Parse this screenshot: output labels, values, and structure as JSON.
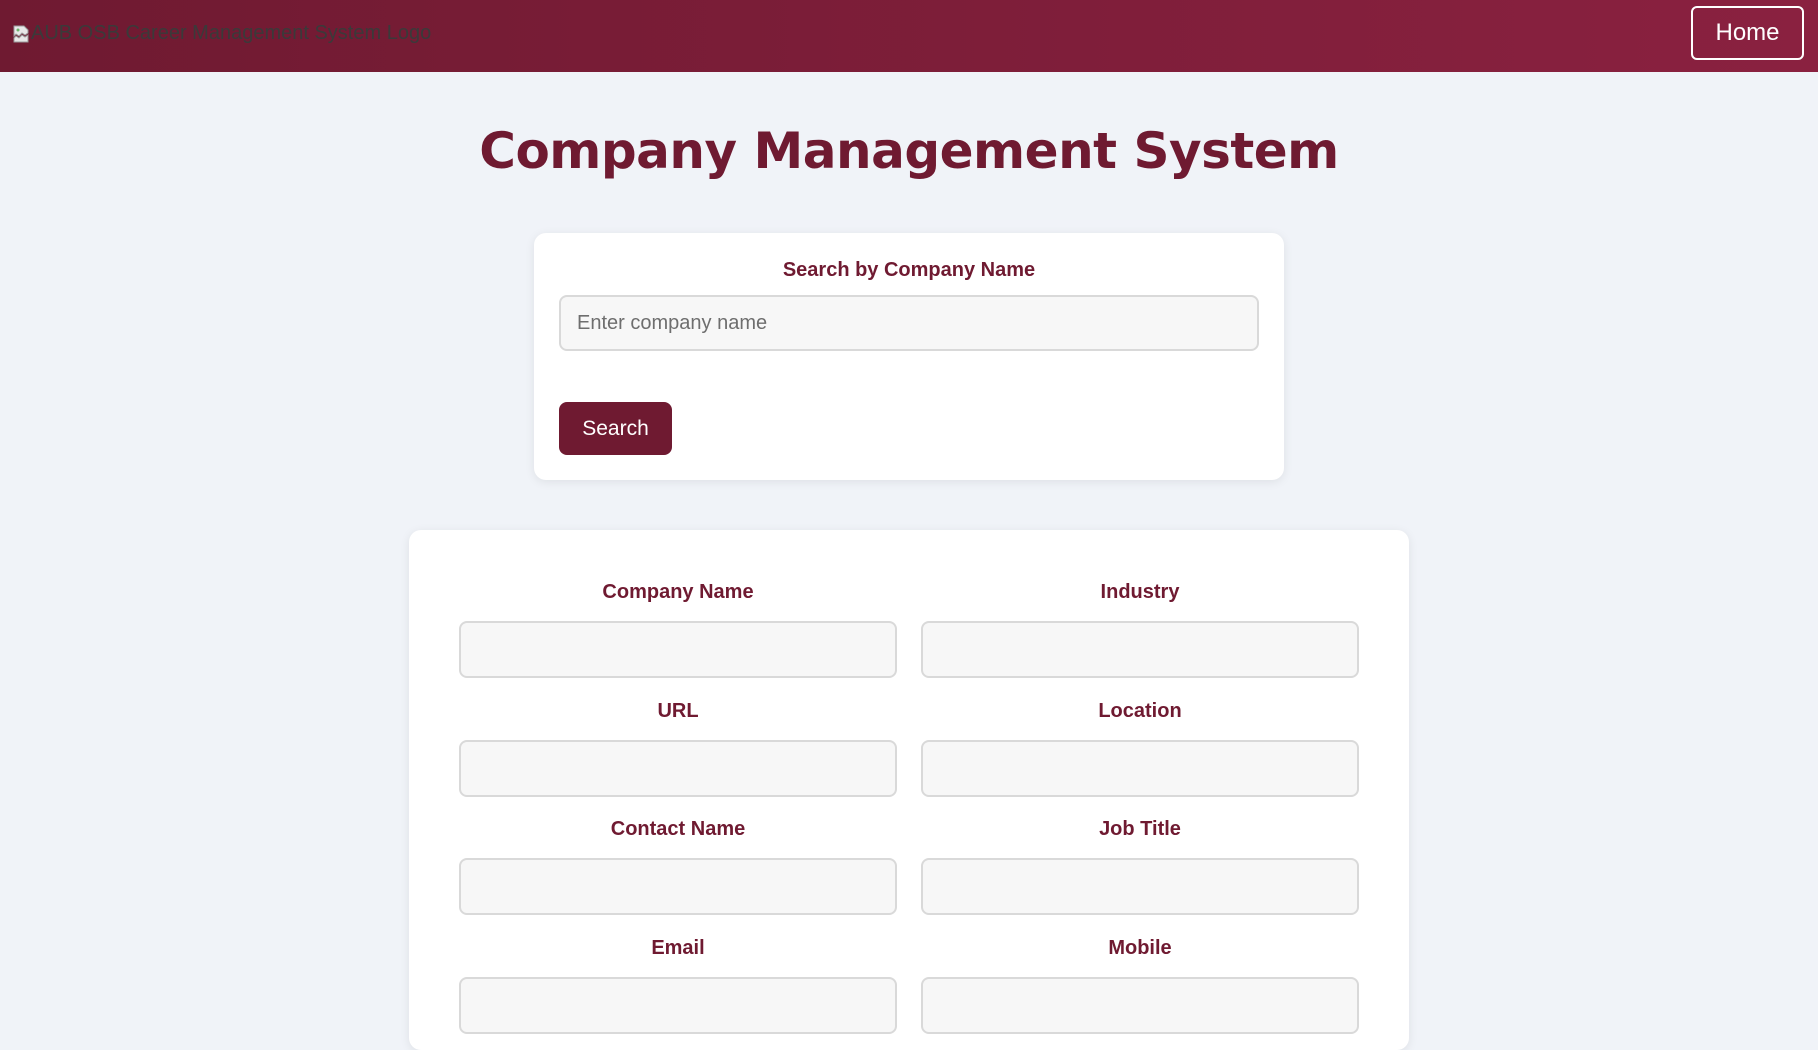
{
  "header": {
    "logo_alt": "AUB OSB Career Management System Logo",
    "home_label": "Home"
  },
  "page": {
    "title": "Company Management System"
  },
  "search": {
    "label": "Search by Company Name",
    "placeholder": "Enter company name",
    "value": "",
    "button_label": "Search"
  },
  "form": {
    "fields": [
      {
        "label": "Company Name",
        "value": ""
      },
      {
        "label": "Industry",
        "value": ""
      },
      {
        "label": "URL",
        "value": ""
      },
      {
        "label": "Location",
        "value": ""
      },
      {
        "label": "Contact Name",
        "value": ""
      },
      {
        "label": "Job Title",
        "value": ""
      },
      {
        "label": "Email",
        "value": ""
      },
      {
        "label": "Mobile",
        "value": ""
      }
    ]
  },
  "colors": {
    "brand": "#6f1a31",
    "header_gradient_end": "#8a2140",
    "page_background": "#f0f3f8",
    "card_background": "#ffffff",
    "input_background": "#f7f7f7"
  },
  "icons": {
    "logo": "broken-image-icon"
  }
}
